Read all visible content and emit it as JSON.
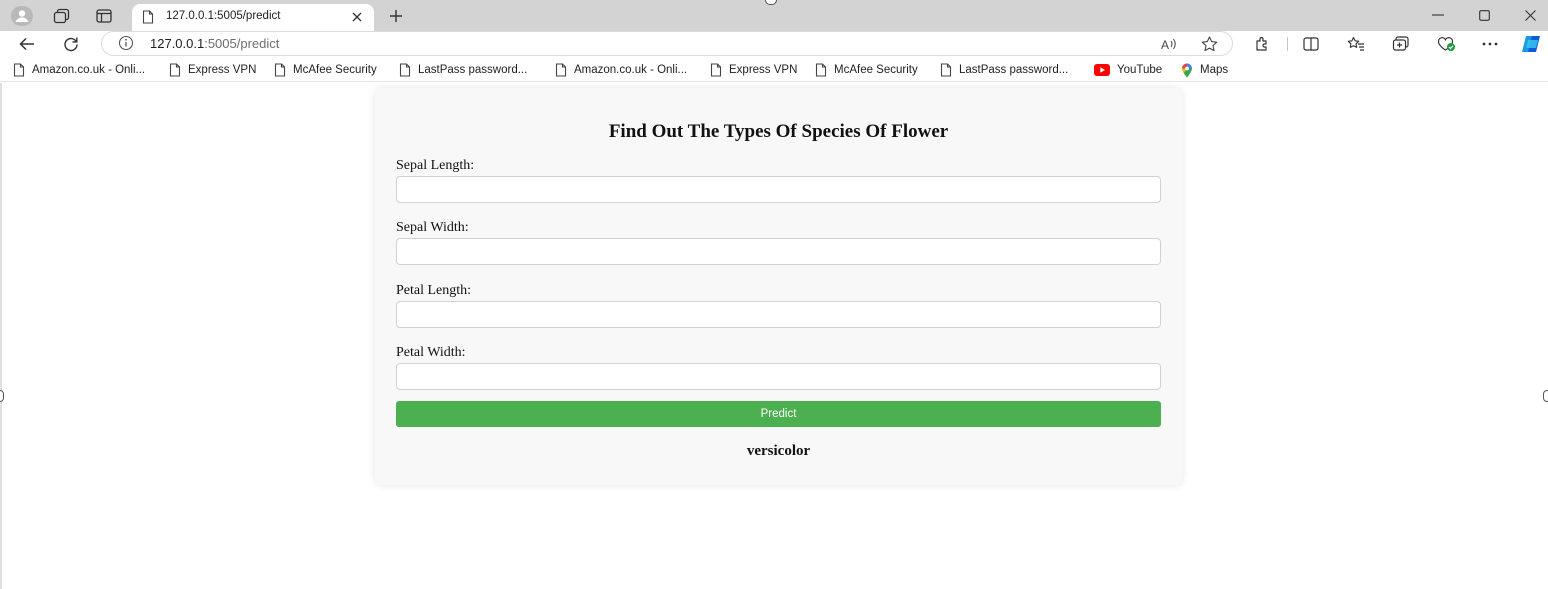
{
  "browser": {
    "tab": {
      "title": "127.0.0.1:5005/predict"
    },
    "address_bar": {
      "host": "127.0.0.1",
      "path": ":5005/predict"
    },
    "bookmarks": [
      {
        "label": "Amazon.co.uk - Onli...",
        "icon": "page-icon"
      },
      {
        "label": "Express VPN",
        "icon": "page-icon"
      },
      {
        "label": "McAfee Security",
        "icon": "page-icon"
      },
      {
        "label": "LastPass password...",
        "icon": "page-icon"
      },
      {
        "label": "Amazon.co.uk - Onli...",
        "icon": "page-icon"
      },
      {
        "label": "Express VPN",
        "icon": "page-icon"
      },
      {
        "label": "McAfee Security",
        "icon": "page-icon"
      },
      {
        "label": "LastPass password...",
        "icon": "page-icon"
      },
      {
        "label": "YouTube",
        "icon": "youtube-icon"
      },
      {
        "label": "Maps",
        "icon": "maps-icon"
      }
    ],
    "accent_color": "#0b5cd5"
  },
  "page": {
    "title": "Find Out The Types Of Species Of Flower",
    "fields": [
      {
        "label": "Sepal Length:",
        "value": "",
        "placeholder": ""
      },
      {
        "label": "Sepal Width:",
        "value": "",
        "placeholder": ""
      },
      {
        "label": "Petal Length:",
        "value": "",
        "placeholder": ""
      },
      {
        "label": "Petal Width:",
        "value": "",
        "placeholder": ""
      }
    ],
    "submit_label": "Predict",
    "submit_color": "#4caf50",
    "result": "versicolor"
  }
}
